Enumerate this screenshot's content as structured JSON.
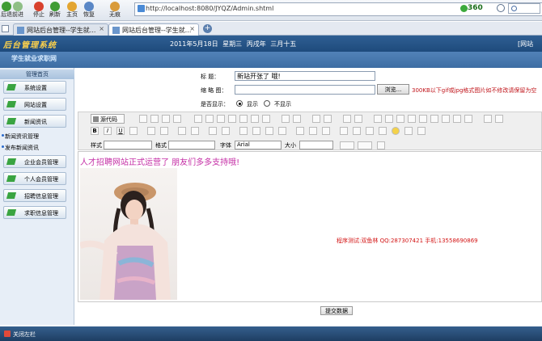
{
  "browser": {
    "nav_buttons": [
      {
        "label": "后退",
        "color": "#3f9c35"
      },
      {
        "label": "前进",
        "color": "#8fbf86"
      },
      {
        "label": "停止",
        "color": "#d8412d"
      },
      {
        "label": "刷新",
        "color": "#3f9c35"
      },
      {
        "label": "主页",
        "color": "#e3a531"
      },
      {
        "label": "恢复",
        "color": "#5a87c6"
      },
      {
        "label": "无痕",
        "color": "#d99b3a"
      }
    ],
    "url": "http://localhost:8080/JYQZ/Admin.shtml",
    "score": "360",
    "tabs": [
      {
        "label": "网站后台管理--学生就..."
      },
      {
        "label": "网站后台管理--学生就..."
      }
    ]
  },
  "header": {
    "logo": "后台管理系统",
    "date": "2011年5月18日 星期三 丙戌年 三月十五",
    "right": "[网站"
  },
  "banner": {
    "title": "学生就业求职网"
  },
  "sidebar": {
    "heading": "管理首页",
    "items": [
      {
        "label": "系统设置"
      },
      {
        "label": "网站设置"
      },
      {
        "label": "新闻资讯"
      }
    ],
    "sub_items": [
      {
        "label": "新闻资讯管理"
      },
      {
        "label": "发布新闻资讯"
      }
    ],
    "items2": [
      {
        "label": "企业会员管理"
      },
      {
        "label": "个人会员管理"
      },
      {
        "label": "招聘信息管理"
      },
      {
        "label": "求职信息管理"
      }
    ]
  },
  "form": {
    "title_label": "标 题：",
    "title_value": "新站开张了 哦!",
    "thumb_label": "缩 略 图：",
    "browse_label": "浏览...",
    "hint": "300KB以下gif或jpg格式图片如不修改请保留为空",
    "show_label": "是否显示：",
    "show_yes": "显示",
    "show_no": "不显示"
  },
  "editor": {
    "source_label": "源代码",
    "style_label": "样式",
    "format_label": "格式",
    "font_label": "字体",
    "font_value": "Arial",
    "size_label": "大小",
    "content_text": "人才招聘网站正式运营了 朋友们多多支持哦!",
    "credit": "程序测试:双鱼林 QQ:287307421 手机:13558690869",
    "submit_label": "提交数据"
  },
  "footer": {
    "label": "关闭左栏"
  }
}
